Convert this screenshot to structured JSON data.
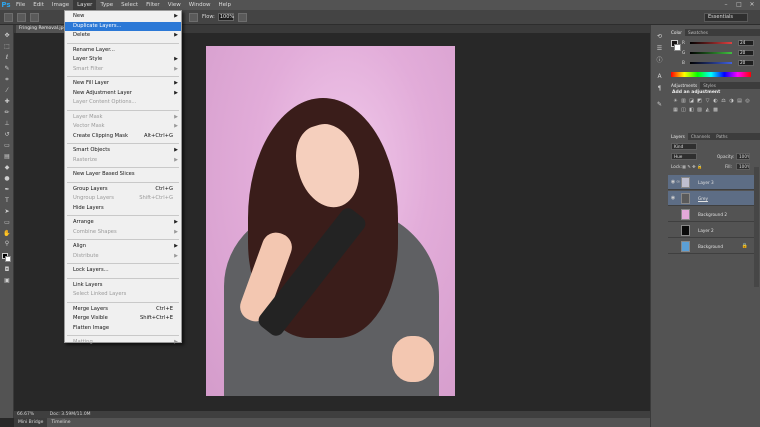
{
  "app": {
    "logo": "Ps"
  },
  "menubar": {
    "items": [
      "File",
      "Edit",
      "Image",
      "Layer",
      "Type",
      "Select",
      "Filter",
      "View",
      "Window",
      "Help"
    ],
    "active": "Layer"
  },
  "window_controls": {
    "minimize": "–",
    "maximize": "□",
    "close": "✕"
  },
  "options_bar": {
    "flow_label": "Flow:",
    "flow_value": "100%",
    "workspace": "Essentials"
  },
  "document": {
    "tab_label": "Fringing Removal.jpg"
  },
  "status_bar": {
    "zoom": "66.67%",
    "doc_info": "Doc: 3.59M/11.0M"
  },
  "bottom_tabs": [
    "Mini Bridge",
    "Timeline"
  ],
  "layer_menu": {
    "groups": [
      [
        {
          "label": "New",
          "arrow": true
        },
        {
          "label": "Duplicate Layers...",
          "highlight": true
        },
        {
          "label": "Delete",
          "arrow": true
        }
      ],
      [
        {
          "label": "Rename Layer..."
        },
        {
          "label": "Layer Style",
          "arrow": true
        },
        {
          "label": "Smart Filter",
          "disabled": true,
          "arrow": true
        }
      ],
      [
        {
          "label": "New Fill Layer",
          "arrow": true
        },
        {
          "label": "New Adjustment Layer",
          "arrow": true
        },
        {
          "label": "Layer Content Options...",
          "disabled": true
        }
      ],
      [
        {
          "label": "Layer Mask",
          "disabled": true,
          "arrow": true
        },
        {
          "label": "Vector Mask",
          "disabled": true,
          "arrow": true
        },
        {
          "label": "Create Clipping Mask",
          "shortcut": "Alt+Ctrl+G"
        }
      ],
      [
        {
          "label": "Smart Objects",
          "arrow": true
        },
        {
          "label": "Rasterize",
          "disabled": true,
          "arrow": true
        }
      ],
      [
        {
          "label": "New Layer Based Slices"
        }
      ],
      [
        {
          "label": "Group Layers",
          "shortcut": "Ctrl+G"
        },
        {
          "label": "Ungroup Layers",
          "shortcut": "Shift+Ctrl+G",
          "disabled": true
        },
        {
          "label": "Hide Layers"
        }
      ],
      [
        {
          "label": "Arrange",
          "arrow": true
        },
        {
          "label": "Combine Shapes",
          "disabled": true,
          "arrow": true
        }
      ],
      [
        {
          "label": "Align",
          "arrow": true
        },
        {
          "label": "Distribute",
          "disabled": true,
          "arrow": true
        }
      ],
      [
        {
          "label": "Lock Layers..."
        }
      ],
      [
        {
          "label": "Link Layers"
        },
        {
          "label": "Select Linked Layers",
          "disabled": true
        }
      ],
      [
        {
          "label": "Merge Layers",
          "shortcut": "Ctrl+E"
        },
        {
          "label": "Merge Visible",
          "shortcut": "Shift+Ctrl+E"
        },
        {
          "label": "Flatten Image"
        }
      ],
      [
        {
          "label": "Matting",
          "disabled": true,
          "arrow": true
        }
      ]
    ]
  },
  "color_panel": {
    "tabs": [
      "Color",
      "Swatches"
    ],
    "sliders": [
      {
        "label": "R",
        "value": "24",
        "color": "#e04040"
      },
      {
        "label": "G",
        "value": "20",
        "color": "#40c040"
      },
      {
        "label": "B",
        "value": "20",
        "color": "#4060e0"
      }
    ]
  },
  "adjustments_panel": {
    "tabs": [
      "Adjustments",
      "Styles"
    ],
    "title": "Add an adjustment",
    "icons": [
      "☀",
      "▥",
      "◪",
      "◩",
      "▽",
      "◐",
      "⚖",
      "◑",
      "▤",
      "◎",
      "▦",
      "◫",
      "◧",
      "▨",
      "◭",
      "▩"
    ]
  },
  "layers_panel": {
    "tabs": [
      "Layers",
      "Channels",
      "Paths"
    ],
    "kind": "Kind",
    "blend_mode": "Hue",
    "opacity_label": "Opacity:",
    "opacity_value": "100%",
    "lock_label": "Lock:",
    "fill_label": "Fill:",
    "fill_value": "100%",
    "layers": [
      {
        "name": "Layer 3",
        "thumb": "#bfbfcf",
        "selected": true,
        "visible": true,
        "linked": true
      },
      {
        "name": "Grey",
        "thumb": "#5a5a5a",
        "selected": true,
        "visible": true,
        "underline": true
      },
      {
        "name": "Background 2",
        "thumb": "#e3a9d9",
        "selected": false,
        "visible": false
      },
      {
        "name": "Layer 2",
        "thumb": "#0a0a0a",
        "selected": false,
        "visible": false
      },
      {
        "name": "Background",
        "thumb": "#5b9fd6",
        "selected": false,
        "visible": false,
        "locked": true
      }
    ]
  }
}
